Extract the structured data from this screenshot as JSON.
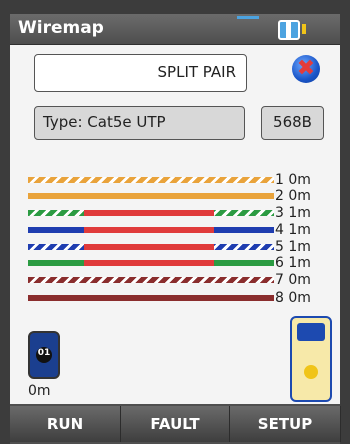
{
  "title": "Wiremap",
  "status_icons": {
    "battery": "battery-icon"
  },
  "result": "SPLIT PAIR",
  "close_icon": "close-icon",
  "cable_type": "Type: Cat5e UTP",
  "standard": "568B",
  "wires": [
    {
      "pair": "1",
      "label": "1 0m",
      "colors": [
        "#e9a33b",
        "#ffffff"
      ],
      "style": "striped",
      "length": 0
    },
    {
      "pair": "2",
      "label": "2 0m",
      "colors": [
        "#e9a33b"
      ],
      "style": "solid",
      "length": 0
    },
    {
      "pair": "3",
      "label": "3 1m",
      "colors": [
        "#2b9b42",
        "#ffffff"
      ],
      "style": "striped",
      "split": true,
      "length": 1
    },
    {
      "pair": "4",
      "label": "4 1m",
      "colors": [
        "#1f3db0"
      ],
      "style": "solid",
      "split": true,
      "length": 1
    },
    {
      "pair": "5",
      "label": "5 1m",
      "colors": [
        "#1f3db0",
        "#ffffff"
      ],
      "style": "striped",
      "split": true,
      "length": 1
    },
    {
      "pair": "6",
      "label": "6 1m",
      "colors": [
        "#2b9b42"
      ],
      "style": "solid",
      "split": true,
      "length": 1
    },
    {
      "pair": "7",
      "label": "7 0m",
      "colors": [
        "#8a2d2d",
        "#ffffff"
      ],
      "style": "striped",
      "length": 0
    },
    {
      "pair": "8",
      "label": "8 0m",
      "colors": [
        "#8a2d2d"
      ],
      "style": "solid",
      "length": 0
    }
  ],
  "split_color": "#e03b3b",
  "remote": {
    "id": "01",
    "distance": "0m"
  },
  "buttons": [
    "RUN",
    "FAULT",
    "SETUP"
  ]
}
